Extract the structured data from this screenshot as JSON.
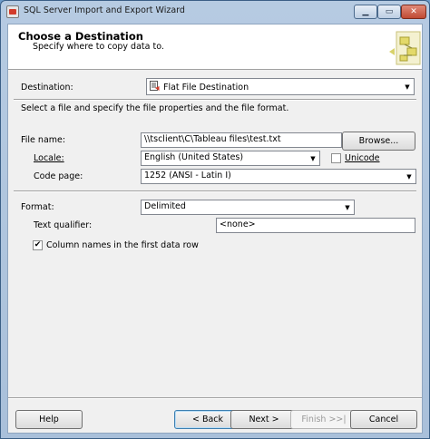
{
  "window": {
    "title": "SQL Server Import and Export Wizard",
    "controls": {
      "minimize": "▁",
      "maximize": "▭",
      "close": "✕"
    }
  },
  "header": {
    "title": "Choose a Destination",
    "subtitle": "Specify where to copy data to.",
    "graphic_icon": "wizard-graphic-icon"
  },
  "destination": {
    "label": "Destination:",
    "value": "Flat File Destination",
    "icon": "flat-file-icon"
  },
  "instruction": "Select a file and specify the file properties and the file format.",
  "file": {
    "file_name_label": "File name:",
    "file_name_value": "\\\\tsclient\\C\\Tableau files\\test.txt",
    "browse_label": "Browse...",
    "locale_label": "Locale:",
    "locale_value": "English (United States)",
    "unicode_label": "Unicode",
    "unicode_checked": false,
    "code_page_label": "Code page:",
    "code_page_value": "1252  (ANSI - Latin I)"
  },
  "format": {
    "format_label": "Format:",
    "format_value": "Delimited",
    "text_qualifier_label": "Text qualifier:",
    "text_qualifier_value": "<none>",
    "column_names_label": "Column names in the first data row",
    "column_names_checked": true
  },
  "footer": {
    "help": "Help",
    "back": "< Back",
    "next": "Next >",
    "finish": "Finish >>|",
    "cancel": "Cancel"
  },
  "colors": {
    "frame": "#a9c0da",
    "client_bg": "#f0f0f0",
    "close_button": "#c04a33"
  }
}
